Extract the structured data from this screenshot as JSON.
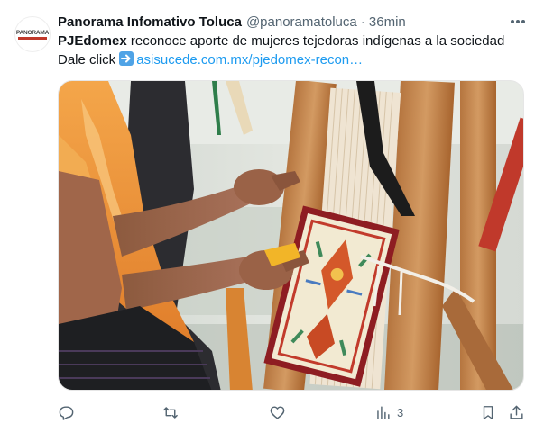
{
  "author": {
    "name": "Panorama Infomativo Toluca",
    "handle": "@panoramatoluca",
    "time": "· 36min",
    "avatar_text": "PANORAMA",
    "avatar_icon": "news-logo"
  },
  "post": {
    "mention": "PJEdomex",
    "text": "reconoce aporte de mujeres tejedoras indígenas a la sociedad",
    "cta": "Dale click",
    "cta_emoji": "right-arrow-emoji",
    "link": "asisucede.com.mx/pjedomex-recon…"
  },
  "media": {
    "type": "photo",
    "subject": "woman weaving colorful textile on a wooden loom"
  },
  "actions": {
    "reply_icon": "reply-icon",
    "repost_icon": "repost-icon",
    "like_icon": "heart-icon",
    "views_icon": "views-icon",
    "views_count": "3",
    "bookmark_icon": "bookmark-icon",
    "share_icon": "share-icon"
  },
  "colors": {
    "text_primary": "#0f1419",
    "text_secondary": "#536471",
    "link": "#1d9bf0"
  }
}
